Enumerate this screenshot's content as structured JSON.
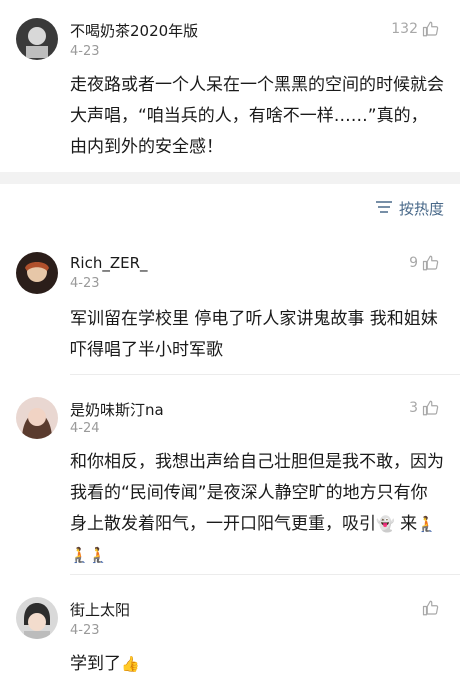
{
  "comments_top": {
    "user": "不喝奶茶2020年版",
    "date": "4-23",
    "likes": "132",
    "text": "走夜路或者一个人呆在一个黑黑的空间的时候就会大声唱，“咱当兵的人，有啥不一样……”真的，由内到外的安全感！"
  },
  "sort": {
    "label": "按热度",
    "icon": "sort-lines-icon"
  },
  "comments": [
    {
      "user": "Rich_ZER_",
      "date": "4-23",
      "likes": "9",
      "text": "军训留在学校里 停电了听人家讲鬼故事 我和姐妹吓得唱了半小时军歌"
    },
    {
      "user": "是奶味斯汀na",
      "date": "4-24",
      "likes": "3",
      "text_main": "和你相反，我想出声给自己壮胆但是我不敢，因为我看的“民间传闻”是夜深人静空旷的地方只有你身上散发着阳气，一开口阳气更重，吸引",
      "emoji_ghost": "👻",
      "text_come": " 来",
      "emoji_tail": "🧎🧎🧎"
    },
    {
      "user": "街上太阳",
      "date": "4-23",
      "likes": "",
      "text": "学到了",
      "emoji_tail": "👍"
    }
  ],
  "colors": {
    "link": "#4a6a8a",
    "muted": "#9a9a9a",
    "band": "#f2f2f2"
  }
}
